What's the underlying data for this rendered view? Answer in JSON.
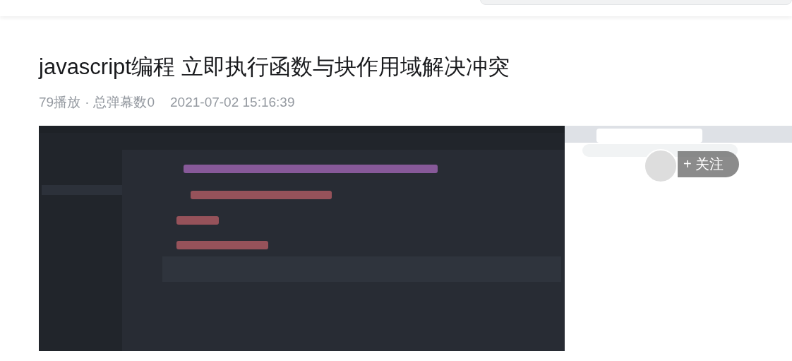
{
  "video": {
    "title": "javascript编程 立即执行函数与块作用域解决冲突",
    "plays": "79播放",
    "separator": "·",
    "danmaku": "总弹幕数0",
    "date": "2021-07-02 15:16:39"
  },
  "player": {
    "kind": "picture",
    "follow_button": {
      "label": "+ 关注"
    }
  }
}
